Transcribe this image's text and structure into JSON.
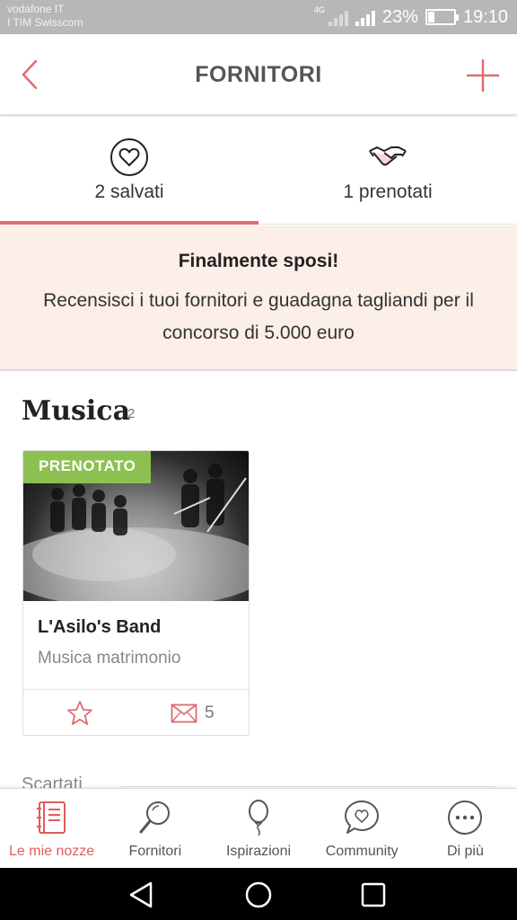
{
  "status_bar": {
    "carrier_line1": "vodafone IT",
    "carrier_line2": "I TIM Swisscom",
    "network_type": "4G",
    "battery": "23%",
    "battery_level": 0.23,
    "time": "19:10"
  },
  "header": {
    "title": "FORNITORI",
    "back_icon": "chevron-left-icon",
    "add_icon": "plus-icon"
  },
  "tabs": [
    {
      "label": "2 salvati",
      "icon": "heart-circle-icon",
      "active": true
    },
    {
      "label": "1 prenotati",
      "icon": "handshake-icon",
      "active": false
    }
  ],
  "banner": {
    "title": "Finalmente sposi!",
    "text": "Recensisci i tuoi fornitori e guadagna tagliandi per il concorso di 5.000 euro"
  },
  "section": {
    "title": "Musica",
    "count": "2"
  },
  "card": {
    "badge": "PRENOTATO",
    "name": "L'Asilo's Band",
    "category": "Musica matrimonio",
    "message_count": "5",
    "actions": [
      "star-icon",
      "envelope-icon"
    ]
  },
  "discarded": {
    "label": "Scartati"
  },
  "bottom_nav": [
    {
      "label": "Le mie nozze",
      "icon": "notebook-icon",
      "active": true
    },
    {
      "label": "Fornitori",
      "icon": "magnifier-icon",
      "active": false
    },
    {
      "label": "Ispirazioni",
      "icon": "balloon-icon",
      "active": false
    },
    {
      "label": "Community",
      "icon": "chat-heart-icon",
      "active": false
    },
    {
      "label": "Di più",
      "icon": "more-dots-icon",
      "active": false
    }
  ],
  "colors": {
    "accent": "#e06d6d",
    "badge_green": "#8cc152",
    "banner_bg": "#fbefe8"
  }
}
